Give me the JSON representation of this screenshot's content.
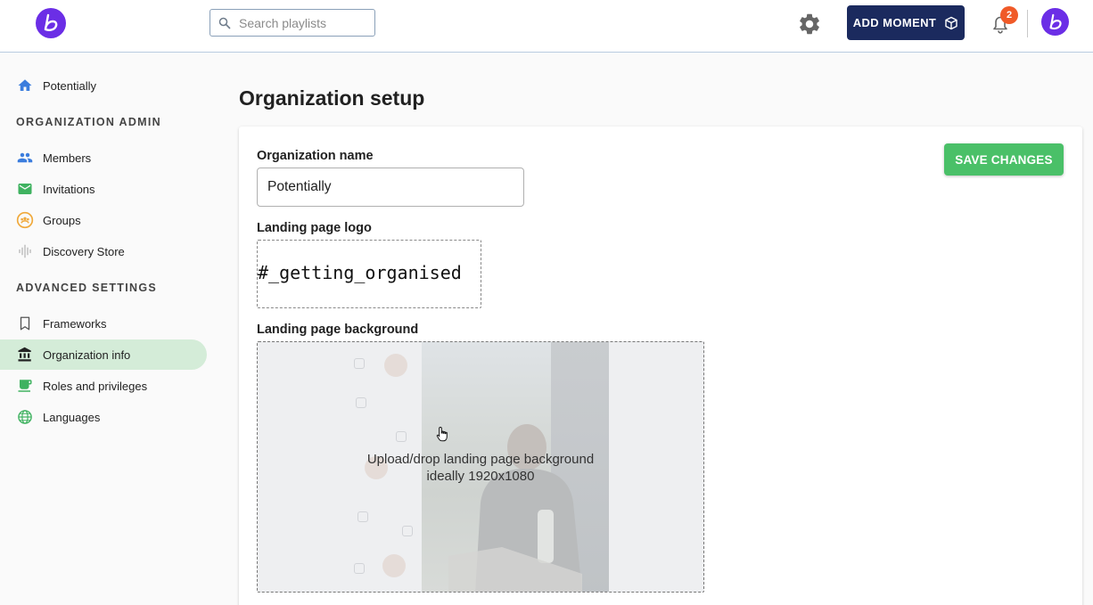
{
  "header": {
    "search_placeholder": "Search playlists",
    "add_moment_label": "ADD MOMENT",
    "notification_count": "2",
    "brand_color": "#6b2ee6",
    "add_moment_color": "#1b2a5e"
  },
  "sidebar": {
    "home_label": "Potentially",
    "org_admin_title": "ORGANIZATION ADMIN",
    "org_admin_items": [
      {
        "label": "Members",
        "icon": "people-icon"
      },
      {
        "label": "Invitations",
        "icon": "mail-icon"
      },
      {
        "label": "Groups",
        "icon": "groups-icon"
      },
      {
        "label": "Discovery Store",
        "icon": "audio-wave-icon"
      }
    ],
    "advanced_title": "ADVANCED SETTINGS",
    "advanced_items": [
      {
        "label": "Frameworks",
        "icon": "bookmark-icon"
      },
      {
        "label": "Organization info",
        "icon": "bank-icon",
        "active": true
      },
      {
        "label": "Roles and privileges",
        "icon": "coffee-cup-icon"
      },
      {
        "label": "Languages",
        "icon": "globe-icon"
      }
    ],
    "active_color": "#d4ecd8"
  },
  "main": {
    "page_title": "Organization setup",
    "save_label": "SAVE CHANGES",
    "save_color": "#4ac068",
    "org_name_label": "Organization name",
    "org_name_value": "Potentially",
    "logo_label": "Landing page logo",
    "logo_text": "#_getting_organised",
    "background_label": "Landing page background",
    "background_hint_line1": "Upload/drop landing page background",
    "background_hint_line2": "ideally 1920x1080"
  }
}
